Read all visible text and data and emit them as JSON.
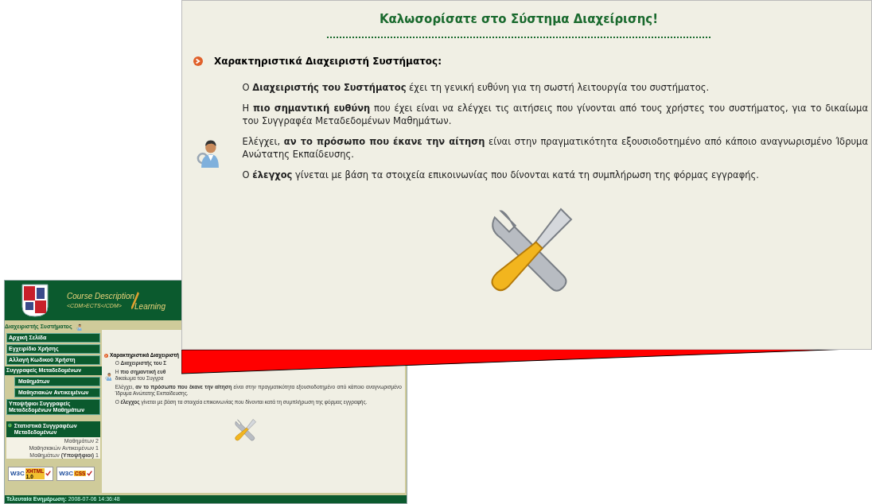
{
  "small_screenshot": {
    "header": {
      "title": "Course Description",
      "subtitle": "<CDM>ECTS</CDM>",
      "cut_word": "Learning"
    },
    "user_label": "Διαχειριστής Συστήματος",
    "menu": [
      {
        "kind": "link",
        "label": "Αρχική Σελίδα"
      },
      {
        "kind": "link",
        "label": "Εγχειρίδιο Χρήσης"
      },
      {
        "kind": "link",
        "label": "Αλλαγή Κωδικού Χρήστη"
      },
      {
        "kind": "heading",
        "label": "Συγγραφείς Μεταδεδομένων"
      },
      {
        "kind": "sublink",
        "label": "Μαθημάτων"
      },
      {
        "kind": "sublink",
        "label": "Μαθησιακών Αντικειμένων"
      },
      {
        "kind": "link",
        "label": "Υποψήφιοι Συγγραφείς Μεταδεδομένων Μαθημάτων"
      }
    ],
    "stats": {
      "title": "Στατιστικά Συγγραφέων Μεταδεδομένων",
      "rows": [
        "Μαθημάτων 2",
        "Μαθησιακών Αντικειμένων 1",
        "Μαθημάτων **(Υποψήφιοι)** 1"
      ]
    },
    "badges": [
      {
        "w3c": "W3C",
        "label": "XHTML",
        "version": "1.0"
      },
      {
        "w3c": "W3C",
        "label": "CSS"
      }
    ],
    "content": {
      "heading": "Χαρακτηριστικά Διαχειριστή",
      "paragraphs": [
        [
          "Ο **Διαχειριστής του Σ**"
        ],
        [
          "Η **πιο σημαντική ευθ**",
          "δικαίωμα του Συγγρα"
        ],
        [
          "Ελέγχει, **αν το πρόσωπο που έκανε την αίτηση** είναι στην πραγματικότητα εξουσιοδοτημένο από κάποιο αναγνωρισμένο Ίδρυμα Ανώτατης Εκπαίδευσης."
        ],
        [
          "Ο **έλεγχος** γίνεται με βάση τα στοιχεία επικοινωνίας που δίνονται κατά τη συμπλήρωση της φόρμας εγγραφής."
        ]
      ]
    },
    "footer": "**Τελευταία Ενημέρωση:** 2008-07-06 14:36:48"
  },
  "zoomed_panel": {
    "title": "Καλωσορίσατε στο Σύστημα Διαχείρισης!",
    "heading": "Χαρακτηριστικά Διαχειριστή Συστήματος:",
    "paragraphs": [
      "Ο **Διαχειριστής του Συστήματος** έχει τη γενική ευθύνη για τη σωστή λειτουργία του συστήματος.",
      "Η **πιο σημαντική ευθύνη** που έχει είναι να ελέγχει τις αιτήσεις που γίνονται από τους χρήστες του συστήματος, για το δικαίωμα του Συγγραφέα Μεταδεδομένων Μαθημάτων.",
      "Ελέγχει, **αν το πρόσωπο που έκανε την αίτηση** είναι στην πραγματικότητα εξουσιοδοτημένο από κάποιο αναγνωρισμένο Ίδρυμα Ανώτατης Εκπαίδευσης.",
      "Ο **έλεγχος** γίνεται με βάση τα στοιχεία επικοινωνίας που δίνονται κατά τη συμπλήρωση της φόρμας εγγραφής."
    ]
  }
}
